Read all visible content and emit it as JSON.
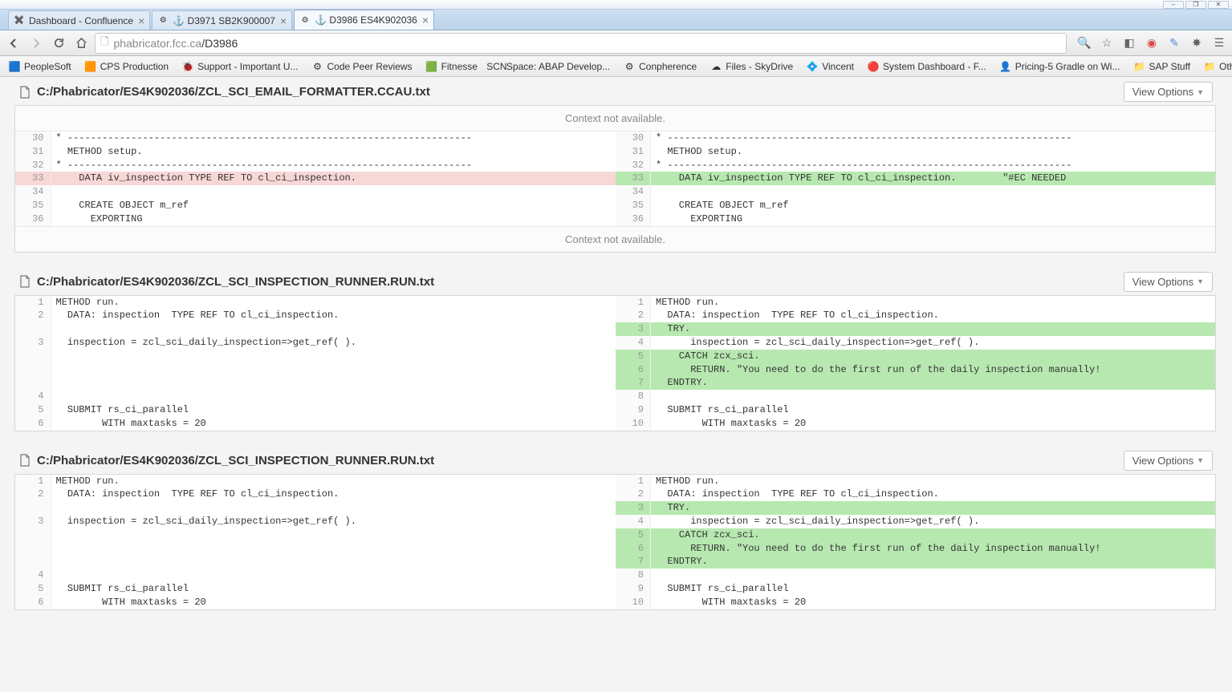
{
  "window": {
    "minimize": "–",
    "maximize": "❐",
    "close": "✕"
  },
  "tabs": [
    {
      "title": "Dashboard - Confluence",
      "favicon": "✖️",
      "active": false
    },
    {
      "title": "⚓ D3971 SB2K900007",
      "favicon": "⚙",
      "active": false
    },
    {
      "title": "⚓ D3986 ES4K902036",
      "favicon": "⚙",
      "active": true
    }
  ],
  "toolbar": {
    "url_host": "phabricator.fcc.ca",
    "url_path": "/D3986"
  },
  "bookmarks": [
    {
      "label": "PeopleSoft",
      "icon": "🟦"
    },
    {
      "label": "CPS Production",
      "icon": "🟧"
    },
    {
      "label": "Support - Important U...",
      "icon": "🐞"
    },
    {
      "label": "Code Peer Reviews",
      "icon": "⚙"
    },
    {
      "label": "Fitnesse",
      "icon": "🟩"
    },
    {
      "label": "Space: ABAP Develop...",
      "icon": "SCN"
    },
    {
      "label": "Conpherence",
      "icon": "⚙"
    },
    {
      "label": "Files - SkyDrive",
      "icon": "☁"
    },
    {
      "label": "Vincent",
      "icon": "💠"
    },
    {
      "label": "System Dashboard - F...",
      "icon": "🔴"
    },
    {
      "label": "Pricing-5 Gradle on Wi...",
      "icon": "👤"
    },
    {
      "label": "SAP Stuff",
      "icon": "📁"
    }
  ],
  "other_bookmarks": "Other bookmarks",
  "view_options_label": "View Options",
  "context_not_available": "Context not available.",
  "files": [
    {
      "path": "C:/Phabricator/ES4K902036/ZCL_SCI_EMAIL_FORMATTER.CCAU.txt",
      "top_context": true,
      "bottom_context": true,
      "rows": [
        {
          "ln_l": "30",
          "code_l": "* ----------------------------------------------------------------------",
          "ln_r": "30",
          "code_r": "* ----------------------------------------------------------------------",
          "type": "ctx"
        },
        {
          "ln_l": "31",
          "code_l": "  METHOD setup.",
          "ln_r": "31",
          "code_r": "  METHOD setup.",
          "type": "ctx"
        },
        {
          "ln_l": "32",
          "code_l": "* ----------------------------------------------------------------------",
          "ln_r": "32",
          "code_r": "* ----------------------------------------------------------------------",
          "type": "ctx"
        },
        {
          "ln_l": "33",
          "code_l": "    DATA iv_inspection TYPE REF TO cl_ci_inspection.",
          "ln_r": "33",
          "code_r": "    DATA iv_inspection TYPE REF TO cl_ci_inspection.        \"#EC NEEDED",
          "type": "changed"
        },
        {
          "ln_l": "34",
          "code_l": "",
          "ln_r": "34",
          "code_r": "",
          "type": "ctx"
        },
        {
          "ln_l": "35",
          "code_l": "    CREATE OBJECT m_ref",
          "ln_r": "35",
          "code_r": "    CREATE OBJECT m_ref",
          "type": "ctx"
        },
        {
          "ln_l": "36",
          "code_l": "      EXPORTING",
          "ln_r": "36",
          "code_r": "      EXPORTING",
          "type": "ctx"
        }
      ]
    },
    {
      "path": "C:/Phabricator/ES4K902036/ZCL_SCI_INSPECTION_RUNNER.RUN.txt",
      "top_context": false,
      "bottom_context": false,
      "rows": [
        {
          "ln_l": "1",
          "code_l": "METHOD run.",
          "ln_r": "1",
          "code_r": "METHOD run.",
          "type": "ctx"
        },
        {
          "ln_l": "2",
          "code_l": "  DATA: inspection  TYPE REF TO cl_ci_inspection.",
          "ln_r": "2",
          "code_r": "  DATA: inspection  TYPE REF TO cl_ci_inspection.",
          "type": "ctx"
        },
        {
          "ln_l": "",
          "code_l": "",
          "ln_r": "3",
          "code_r": "  TRY.",
          "type": "added-only"
        },
        {
          "ln_l": "3",
          "code_l": "  inspection = zcl_sci_daily_inspection=>get_ref( ).",
          "ln_r": "4",
          "code_r": "      inspection = zcl_sci_daily_inspection=>get_ref( ).",
          "type": "ctx"
        },
        {
          "ln_l": "",
          "code_l": "",
          "ln_r": "5",
          "code_r": "    CATCH zcx_sci.",
          "type": "added-only"
        },
        {
          "ln_l": "",
          "code_l": "",
          "ln_r": "6",
          "code_r": "      RETURN. \"You need to do the first run of the daily inspection manually!",
          "type": "added-only"
        },
        {
          "ln_l": "",
          "code_l": "",
          "ln_r": "7",
          "code_r": "  ENDTRY.",
          "type": "added-only"
        },
        {
          "ln_l": "4",
          "code_l": "",
          "ln_r": "8",
          "code_r": "",
          "type": "ctx"
        },
        {
          "ln_l": "5",
          "code_l": "  SUBMIT rs_ci_parallel",
          "ln_r": "9",
          "code_r": "  SUBMIT rs_ci_parallel",
          "type": "ctx"
        },
        {
          "ln_l": "6",
          "code_l": "        WITH maxtasks = 20",
          "ln_r": "10",
          "code_r": "        WITH maxtasks = 20",
          "type": "ctx"
        }
      ]
    },
    {
      "path": "C:/Phabricator/ES4K902036/ZCL_SCI_INSPECTION_RUNNER.RUN.txt",
      "top_context": false,
      "bottom_context": false,
      "rows": [
        {
          "ln_l": "1",
          "code_l": "METHOD run.",
          "ln_r": "1",
          "code_r": "METHOD run.",
          "type": "ctx"
        },
        {
          "ln_l": "2",
          "code_l": "  DATA: inspection  TYPE REF TO cl_ci_inspection.",
          "ln_r": "2",
          "code_r": "  DATA: inspection  TYPE REF TO cl_ci_inspection.",
          "type": "ctx"
        },
        {
          "ln_l": "",
          "code_l": "",
          "ln_r": "3",
          "code_r": "  TRY.",
          "type": "added-only"
        },
        {
          "ln_l": "3",
          "code_l": "  inspection = zcl_sci_daily_inspection=>get_ref( ).",
          "ln_r": "4",
          "code_r": "      inspection = zcl_sci_daily_inspection=>get_ref( ).",
          "type": "ctx"
        },
        {
          "ln_l": "",
          "code_l": "",
          "ln_r": "5",
          "code_r": "    CATCH zcx_sci.",
          "type": "added-only"
        },
        {
          "ln_l": "",
          "code_l": "",
          "ln_r": "6",
          "code_r": "      RETURN. \"You need to do the first run of the daily inspection manually!",
          "type": "added-only"
        },
        {
          "ln_l": "",
          "code_l": "",
          "ln_r": "7",
          "code_r": "  ENDTRY.",
          "type": "added-only"
        },
        {
          "ln_l": "4",
          "code_l": "",
          "ln_r": "8",
          "code_r": "",
          "type": "ctx"
        },
        {
          "ln_l": "5",
          "code_l": "  SUBMIT rs_ci_parallel",
          "ln_r": "9",
          "code_r": "  SUBMIT rs_ci_parallel",
          "type": "ctx"
        },
        {
          "ln_l": "6",
          "code_l": "        WITH maxtasks = 20",
          "ln_r": "10",
          "code_r": "        WITH maxtasks = 20",
          "type": "ctx"
        }
      ]
    }
  ]
}
